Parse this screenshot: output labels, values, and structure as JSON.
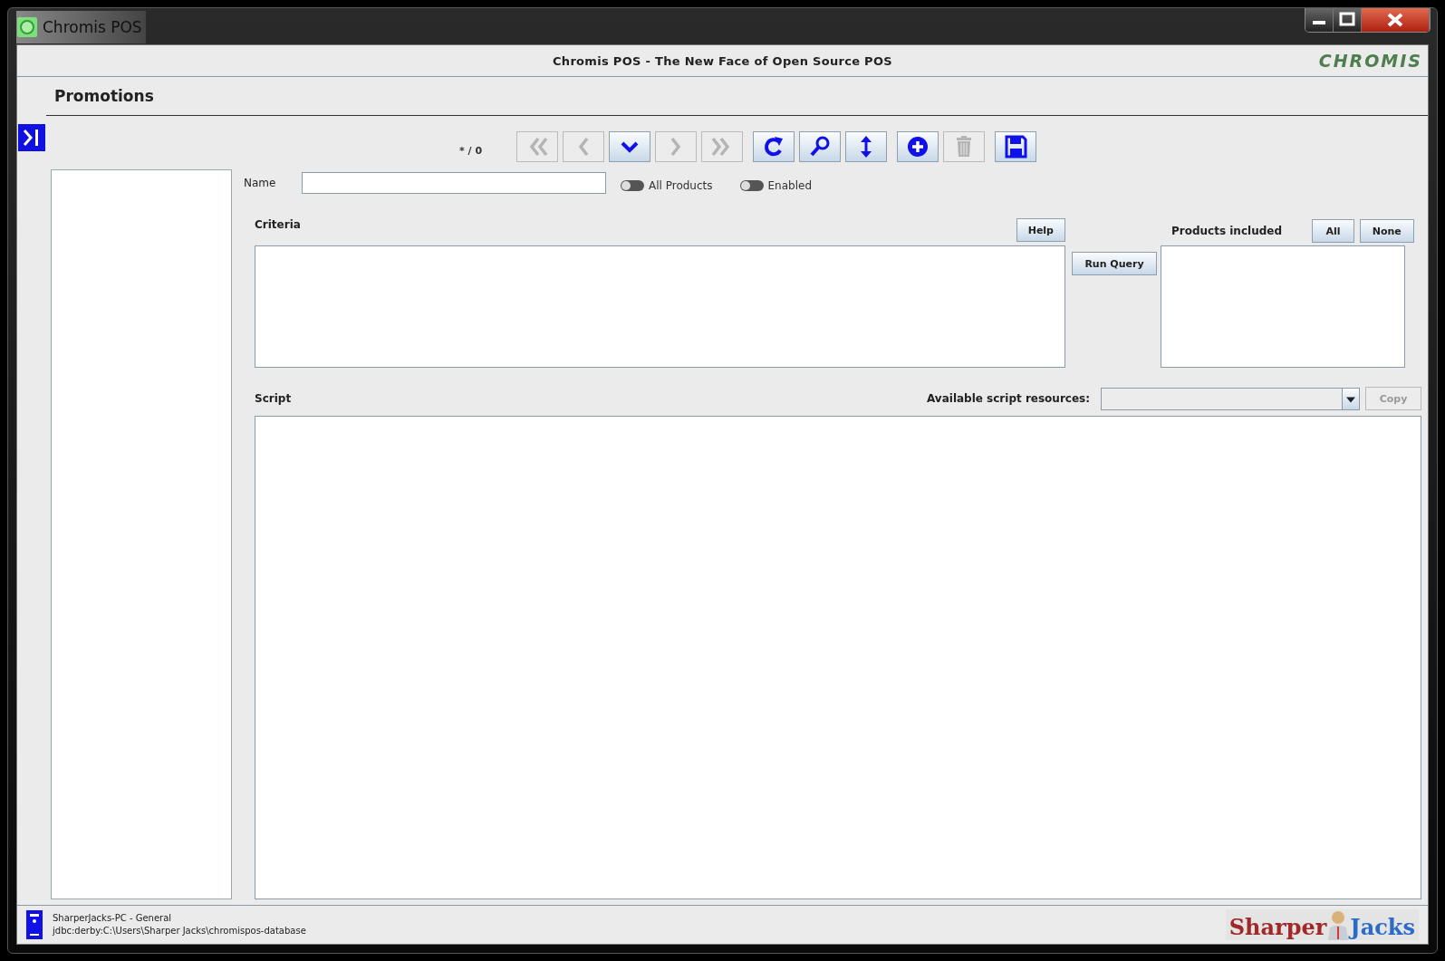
{
  "window": {
    "title": "Chromis POS",
    "controls": [
      {
        "kind": "minimize"
      },
      {
        "kind": "maximize"
      },
      {
        "kind": "close"
      }
    ]
  },
  "app_header": {
    "title": "Chromis POS - The New Face of Open Source POS",
    "logo": "CHROMIS"
  },
  "panel": {
    "title": "Promotions"
  },
  "toolbar": {
    "record_counter": "* / 0",
    "buttons": [
      {
        "kind": "first",
        "disabled": true
      },
      {
        "kind": "previous",
        "disabled": true
      },
      {
        "kind": "down",
        "disabled": false
      },
      {
        "kind": "next",
        "disabled": true
      },
      {
        "kind": "last",
        "disabled": true
      },
      {
        "kind": "refresh",
        "disabled": false
      },
      {
        "kind": "search",
        "disabled": false
      },
      {
        "kind": "sort",
        "disabled": false
      },
      {
        "kind": "add",
        "disabled": false
      },
      {
        "kind": "delete",
        "disabled": true
      },
      {
        "kind": "save",
        "disabled": false
      }
    ]
  },
  "form": {
    "name_label": "Name",
    "toggles": [
      {
        "label": "All Products",
        "on": false
      },
      {
        "label": "Enabled",
        "on": false
      }
    ],
    "criteria_label": "Criteria",
    "help_button": "Help",
    "run_query_button": "Run Query",
    "products_label": "Products included",
    "all_button": "All",
    "none_button": "None",
    "script_label": "Script",
    "resources_label": "Available script resources:",
    "copy_button": {
      "label": "Copy",
      "disabled": true
    }
  },
  "status_bar": {
    "host": "SharperJacks-PC - General",
    "database": "jdbc:derby:C:\\Users\\Sharper Jacks\\chromispos-database",
    "logo": [
      "Sharper",
      "Jacks"
    ]
  }
}
